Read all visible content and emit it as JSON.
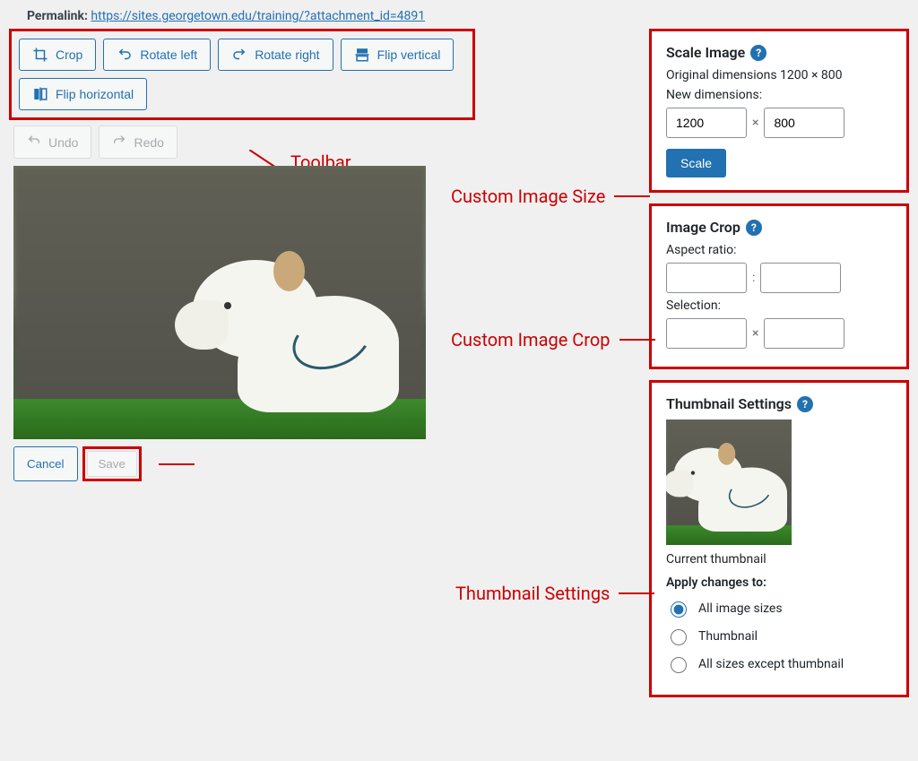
{
  "permalink": {
    "label": "Permalink:",
    "url": "https://sites.georgetown.edu/training/?attachment_id=4891"
  },
  "toolbar": {
    "crop": "Crop",
    "rotate_left": "Rotate left",
    "rotate_right": "Rotate right",
    "flip_vertical": "Flip vertical",
    "flip_horizontal": "Flip horizontal",
    "undo": "Undo",
    "redo": "Redo"
  },
  "annotations": {
    "toolbar": "Toolbar",
    "custom_size": "Custom Image Size",
    "custom_crop": "Custom Image Crop",
    "thumb": "Thumbnail Settings"
  },
  "actions": {
    "cancel": "Cancel",
    "save": "Save"
  },
  "scale": {
    "title": "Scale Image",
    "original": "Original dimensions 1200 × 800",
    "new_label": "New dimensions:",
    "w": "1200",
    "h": "800",
    "button": "Scale"
  },
  "crop_panel": {
    "title": "Image Crop",
    "aspect_label": "Aspect ratio:",
    "sep_colon": ":",
    "selection_label": "Selection:",
    "sep_x": "×"
  },
  "thumb_panel": {
    "title": "Thumbnail Settings",
    "current": "Current thumbnail",
    "apply": "Apply changes to:",
    "opt_all": "All image sizes",
    "opt_thumb": "Thumbnail",
    "opt_except": "All sizes except thumbnail"
  }
}
